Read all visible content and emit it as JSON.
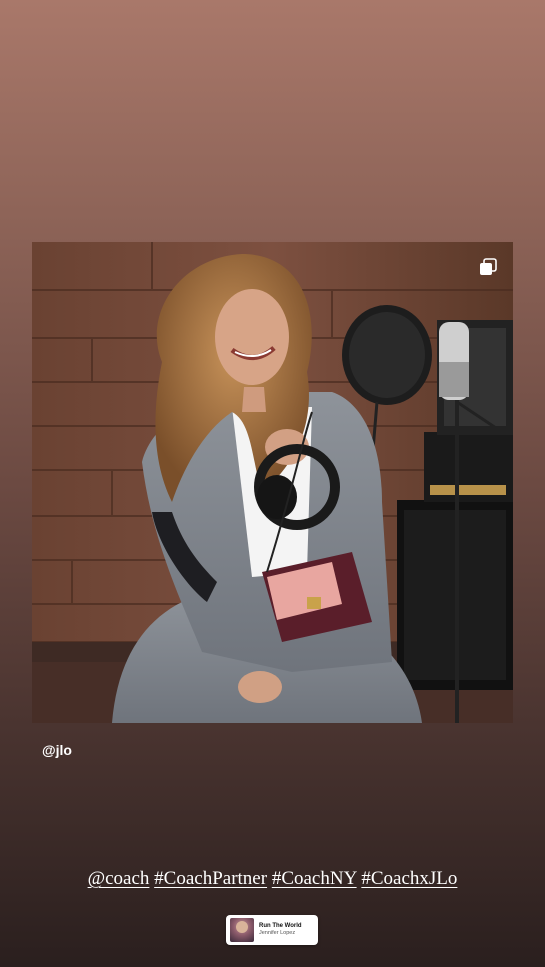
{
  "story": {
    "post_username": "@jlo",
    "caption": {
      "tags": [
        "@coach",
        "#CoachPartner",
        "#CoachNY",
        "#CoachxJLo"
      ]
    },
    "music": {
      "title": "Run The World",
      "artist": "Jennifer Lopez"
    },
    "icons": {
      "multi_photo": "multiple-photos-icon"
    },
    "colors": {
      "background_top": "#a9786a",
      "background_bottom": "#2a1f1e",
      "text": "#ffffff"
    }
  }
}
